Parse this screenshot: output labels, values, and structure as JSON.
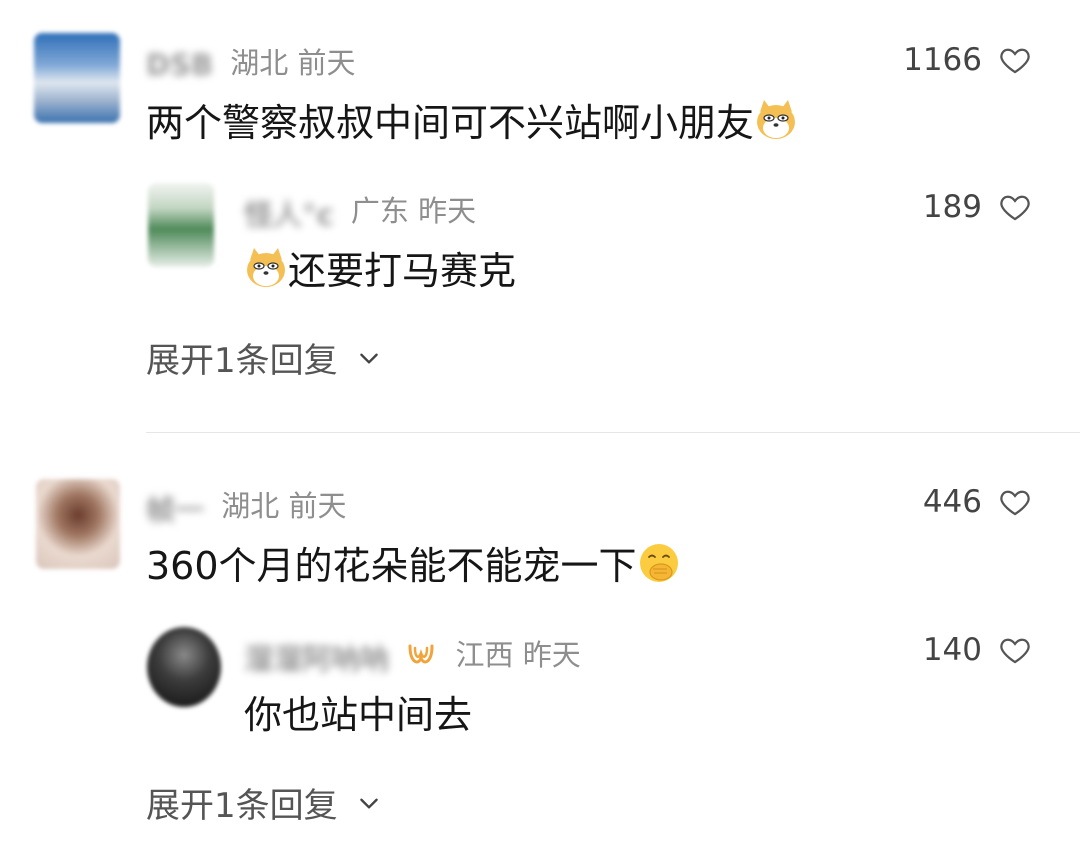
{
  "comments": [
    {
      "user": "DSB",
      "location": "湖北",
      "time": "前天",
      "text": "两个警察叔叔中间可不兴站啊小朋友",
      "emoji": "shiba-emoji",
      "likes": "1166",
      "reply": {
        "user": "怪人°c",
        "location": "广东",
        "time": "昨天",
        "text": "还要打马赛克",
        "emoji": "shiba-emoji",
        "likes": "189"
      },
      "expand_label": "展开1条回复"
    },
    {
      "user": "帧一",
      "location": "湖北",
      "time": "前天",
      "text": "360个月的花朵能不能宠一下",
      "emoji": "face-hand-over-mouth-emoji",
      "likes": "446",
      "reply": {
        "user": "溜溜阿呐呐",
        "location": "江西",
        "time": "昨天",
        "text": "你也站中间去",
        "badge": "orange-badge-icon",
        "likes": "140"
      },
      "expand_label": "展开1条回复"
    }
  ],
  "colors": {
    "meta": "#8e8e8e",
    "text": "#161616",
    "badge": "#f2a33a"
  }
}
